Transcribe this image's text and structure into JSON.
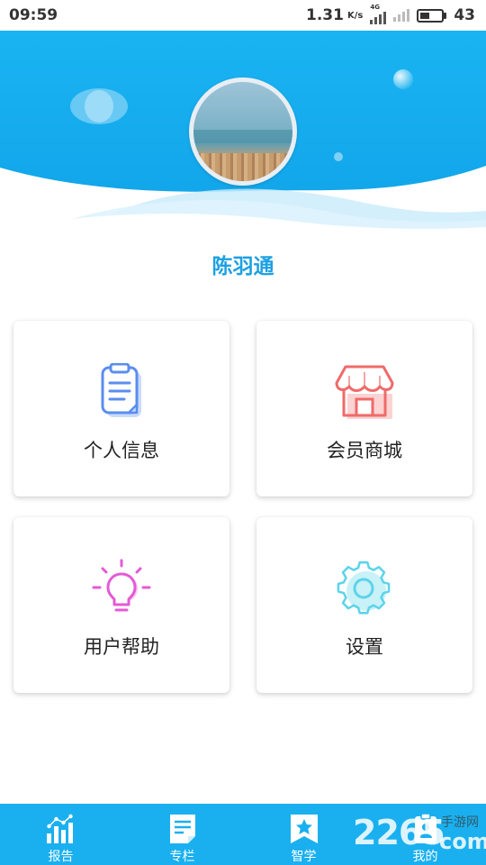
{
  "status_bar": {
    "time": "09:59",
    "speed": "1.31",
    "speed_unit": "K/s",
    "network": "4G",
    "battery": "43",
    "battery_level": 0.43
  },
  "profile": {
    "name": "陈羽通"
  },
  "menu": {
    "profile_label": "个人信息",
    "mall_label": "会员商城",
    "help_label": "用户帮助",
    "settings_label": "设置"
  },
  "nav": {
    "items": [
      {
        "label": "报告",
        "icon": "bar-chart-icon"
      },
      {
        "label": "专栏",
        "icon": "document-icon"
      },
      {
        "label": "智学",
        "icon": "star-bookmark-icon"
      },
      {
        "label": "我的",
        "icon": "user-icon"
      }
    ]
  },
  "watermark": {
    "number": "2265",
    "text": "手游网",
    "domain": "com"
  },
  "colors": {
    "primary": "#1ab0f0",
    "username": "#1da1e2",
    "profile_icon": "#5b8def",
    "mall_icon": "#f06a6a",
    "help_icon": "#e45ad6",
    "settings_icon": "#5cd4ea"
  }
}
